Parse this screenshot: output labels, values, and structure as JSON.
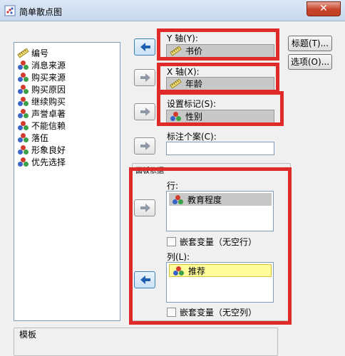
{
  "window": {
    "title": "简单散点图",
    "close_glyph": "✕"
  },
  "variables": [
    {
      "label": "编号",
      "icon": "ruler-icon"
    },
    {
      "label": "消息来源",
      "icon": "nominal-icon"
    },
    {
      "label": "购买来源",
      "icon": "nominal-icon"
    },
    {
      "label": "购买原因",
      "icon": "nominal-icon"
    },
    {
      "label": "继续购买",
      "icon": "nominal-icon"
    },
    {
      "label": "声誉卓著",
      "icon": "nominal-icon"
    },
    {
      "label": "不能信赖",
      "icon": "nominal-icon"
    },
    {
      "label": "落伍",
      "icon": "nominal-icon"
    },
    {
      "label": "形象良好",
      "icon": "nominal-icon"
    },
    {
      "label": "优先选择",
      "icon": "nominal-icon"
    }
  ],
  "y_axis": {
    "label": "Y 轴(Y):",
    "value": "书价"
  },
  "x_axis": {
    "label": "X 轴(X):",
    "value": "年龄"
  },
  "marker": {
    "label": "设置标记(S):",
    "value": "性别"
  },
  "case_label": {
    "label": "标注个案(C):",
    "value": ""
  },
  "buttons": {
    "titles": "标题(T)...",
    "options": "选项(O)..."
  },
  "panel": {
    "title": "面板依据",
    "rows_label": "行:",
    "rows_value": "教育程度",
    "rows_nest": "嵌套变量（无空行）",
    "cols_label": "列(L):",
    "cols_value": "推荐",
    "cols_nest": "嵌套变量（无空列）"
  },
  "template": {
    "title": "模板"
  },
  "colors": {
    "highlight": "#e02a2a",
    "selected_row": "#fffd9b"
  }
}
